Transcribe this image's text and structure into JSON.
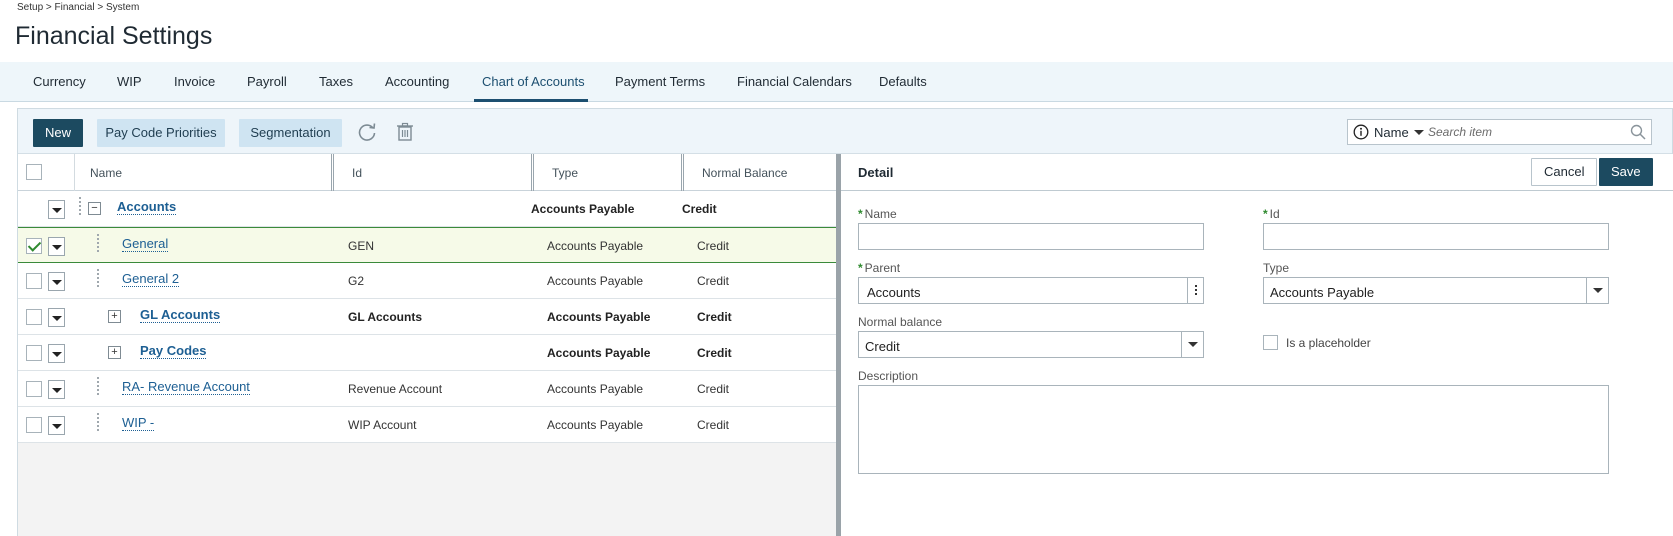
{
  "breadcrumb": "Setup > Financial > System",
  "page_title": "Financial Settings",
  "tabs": [
    {
      "label": "Currency"
    },
    {
      "label": "WIP"
    },
    {
      "label": "Invoice"
    },
    {
      "label": "Payroll"
    },
    {
      "label": "Taxes"
    },
    {
      "label": "Accounting"
    },
    {
      "label": "Chart of Accounts",
      "active": true
    },
    {
      "label": "Payment Terms"
    },
    {
      "label": "Financial Calendars"
    },
    {
      "label": "Defaults"
    }
  ],
  "toolbar": {
    "new_label": "New",
    "pay_code_priorities_label": "Pay Code Priorities",
    "segmentation_label": "Segmentation",
    "refresh_icon": "refresh-icon",
    "delete_icon": "trash-icon"
  },
  "search": {
    "field": "Name",
    "placeholder": "Search item"
  },
  "grid": {
    "columns": [
      "Name",
      "Id",
      "Type",
      "Normal Balance"
    ],
    "rows": [
      {
        "name": "Accounts",
        "id": "",
        "type": "Accounts Payable",
        "balance": "Credit",
        "level": 0,
        "expander": "minus",
        "bold": true,
        "checked": false,
        "has_checkbox": false
      },
      {
        "name": "General",
        "id": "GEN",
        "type": "Accounts Payable",
        "balance": "Credit",
        "level": 1,
        "expander": "",
        "bold": false,
        "checked": true,
        "has_checkbox": true
      },
      {
        "name": "General 2",
        "id": "G2",
        "type": "Accounts Payable",
        "balance": "Credit",
        "level": 1,
        "expander": "",
        "bold": false,
        "checked": false,
        "has_checkbox": true
      },
      {
        "name": "GL Accounts",
        "id": "GL Accounts",
        "type": "Accounts Payable",
        "balance": "Credit",
        "level": 1,
        "expander": "plus",
        "bold": true,
        "checked": false,
        "has_checkbox": true
      },
      {
        "name": "Pay Codes",
        "id": "",
        "type": "Accounts Payable",
        "balance": "Credit",
        "level": 1,
        "expander": "plus",
        "bold": true,
        "checked": false,
        "has_checkbox": true
      },
      {
        "name": "RA- Revenue Account",
        "id": "Revenue Account",
        "type": "Accounts Payable",
        "balance": "Credit",
        "level": 1,
        "expander": "",
        "bold": false,
        "checked": false,
        "has_checkbox": true
      },
      {
        "name": "WIP -",
        "id": "WIP Account",
        "type": "Accounts Payable",
        "balance": "Credit",
        "level": 1,
        "expander": "",
        "bold": false,
        "checked": false,
        "has_checkbox": true
      }
    ]
  },
  "detail": {
    "title": "Detail",
    "cancel_label": "Cancel",
    "save_label": "Save",
    "name_label": "Name",
    "name_value": "",
    "id_label": "Id",
    "id_value": "",
    "parent_label": "Parent",
    "parent_value": "Accounts",
    "type_label": "Type",
    "type_value": "Accounts Payable",
    "normal_balance_label": "Normal balance",
    "normal_balance_value": "Credit",
    "placeholder_label": "Is a placeholder",
    "placeholder_checked": false,
    "description_label": "Description",
    "description_value": ""
  },
  "colors": {
    "primary": "#1c4a60",
    "secondary_button": "#cfe4f2",
    "link": "#1d5f93",
    "selected_row_border": "#3a8a3a",
    "required_marker": "#2f8a2f"
  }
}
